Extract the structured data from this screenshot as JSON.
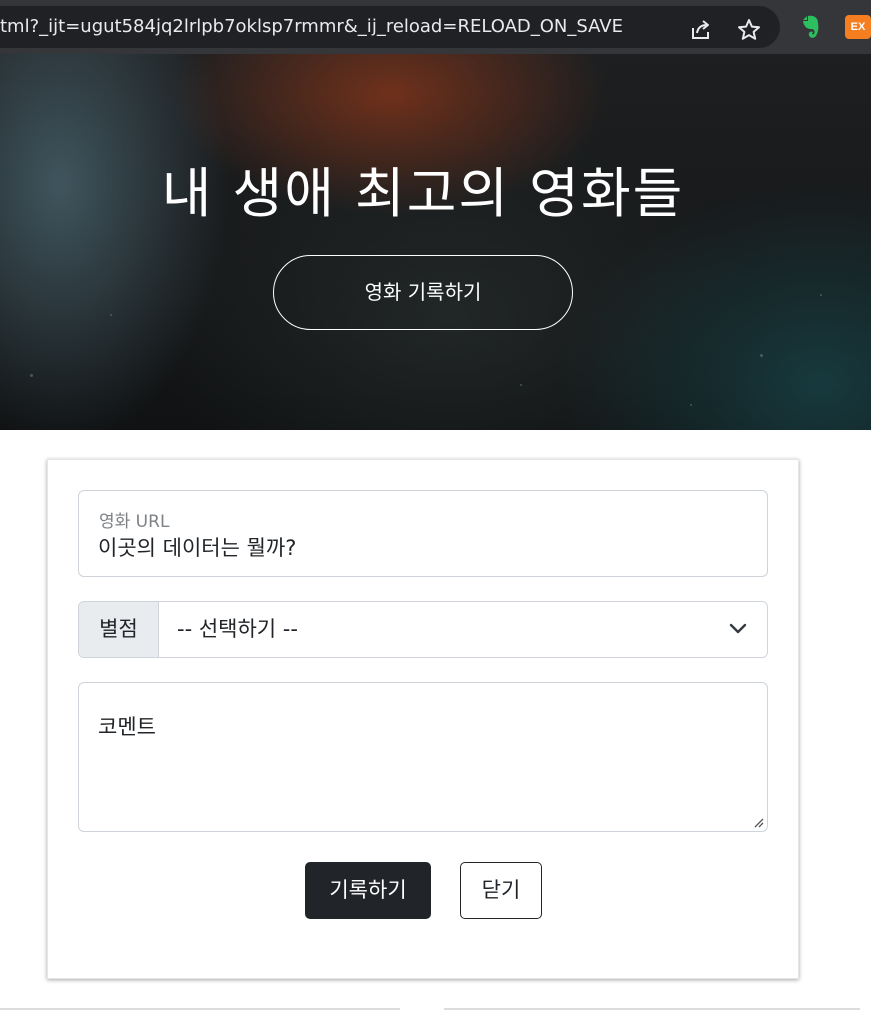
{
  "browser": {
    "url": "tml?_ijt=ugut584jq2lrlpb7oklsp7rmmr&_ij_reload=RELOAD_ON_SAVE",
    "icons": [
      "share-icon",
      "star-icon",
      "evernote-icon",
      "ex-extension-icon"
    ],
    "ex_badge": "EX"
  },
  "hero": {
    "title": "내 생애 최고의 영화들",
    "button_label": "영화 기록하기"
  },
  "form": {
    "url_label": "영화 URL",
    "url_value": "이곳의 데이터는 뭘까?",
    "rating_label": "별점",
    "rating_selected": "-- 선택하기 --",
    "comment_placeholder": "코멘트",
    "submit_label": "기록하기",
    "close_label": "닫기"
  },
  "colors": {
    "primary_button": "#212529",
    "input_border": "#ced4da",
    "addon_background": "#e9ecef"
  }
}
